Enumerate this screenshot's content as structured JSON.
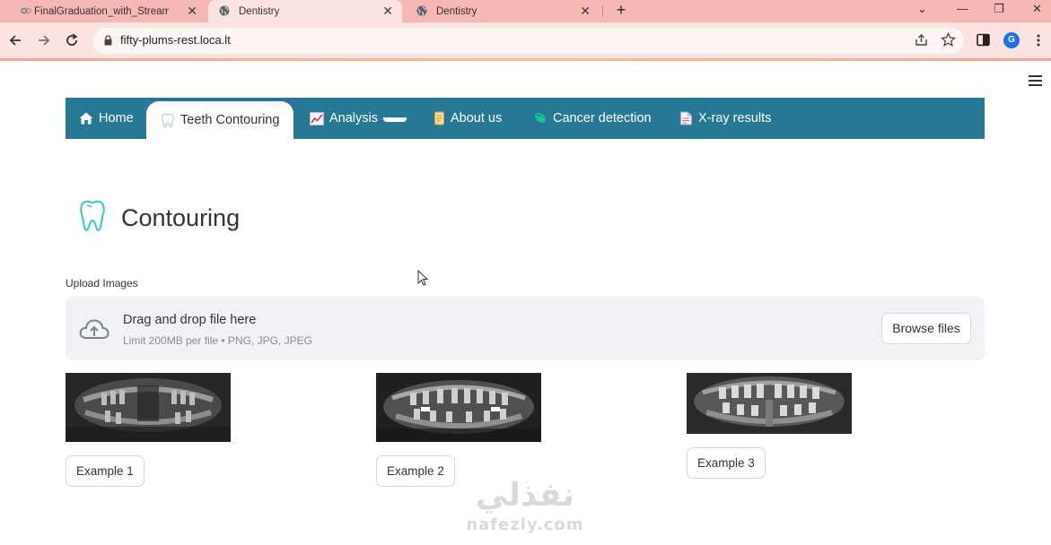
{
  "browser": {
    "tabs": [
      {
        "title": "FinalGraduation_with_Streamlit",
        "active": false,
        "icon": "colab-icon"
      },
      {
        "title": "Dentistry",
        "active": true,
        "icon": "globe-icon"
      },
      {
        "title": "Dentistry",
        "active": false,
        "icon": "globe-icon"
      }
    ],
    "new_tab": "+",
    "url": "fifty-plums-rest.loca.lt",
    "profile_initial": "G",
    "tab_close": "✕",
    "window_controls": {
      "dropdown": "⌄",
      "minimize": "—",
      "restore": "❐",
      "close": "✕"
    }
  },
  "nav": {
    "items": [
      {
        "label": "Home",
        "icon": "home-icon",
        "active": false
      },
      {
        "label": "Teeth Contouring",
        "icon": "tooth-icon",
        "active": true
      },
      {
        "label": "Analysis",
        "icon": "chart-icon",
        "active": false
      },
      {
        "label": "About us",
        "icon": "scroll-icon",
        "active": false
      },
      {
        "label": "Cancer detection",
        "icon": "pill-icon",
        "active": false
      },
      {
        "label": "X-ray results",
        "icon": "document-icon",
        "active": false
      }
    ],
    "background": "#277895"
  },
  "page": {
    "title": "Contouring",
    "upload_label": "Upload Images",
    "dropzone": {
      "main_text": "Drag and drop file here",
      "sub_text": "Limit 200MB per file • PNG, JPG, JPEG",
      "browse_label": "Browse files"
    },
    "examples": [
      {
        "label": "Example 1"
      },
      {
        "label": "Example 2"
      },
      {
        "label": "Example 3"
      }
    ]
  },
  "watermark": {
    "arabic": "نفذلي",
    "latin": "nafezly.com"
  },
  "colors": {
    "tab_bar": "#f6b8b4",
    "toolbar": "#fce3e1",
    "accent": "#277895",
    "dropzone": "#f0f2f6"
  }
}
